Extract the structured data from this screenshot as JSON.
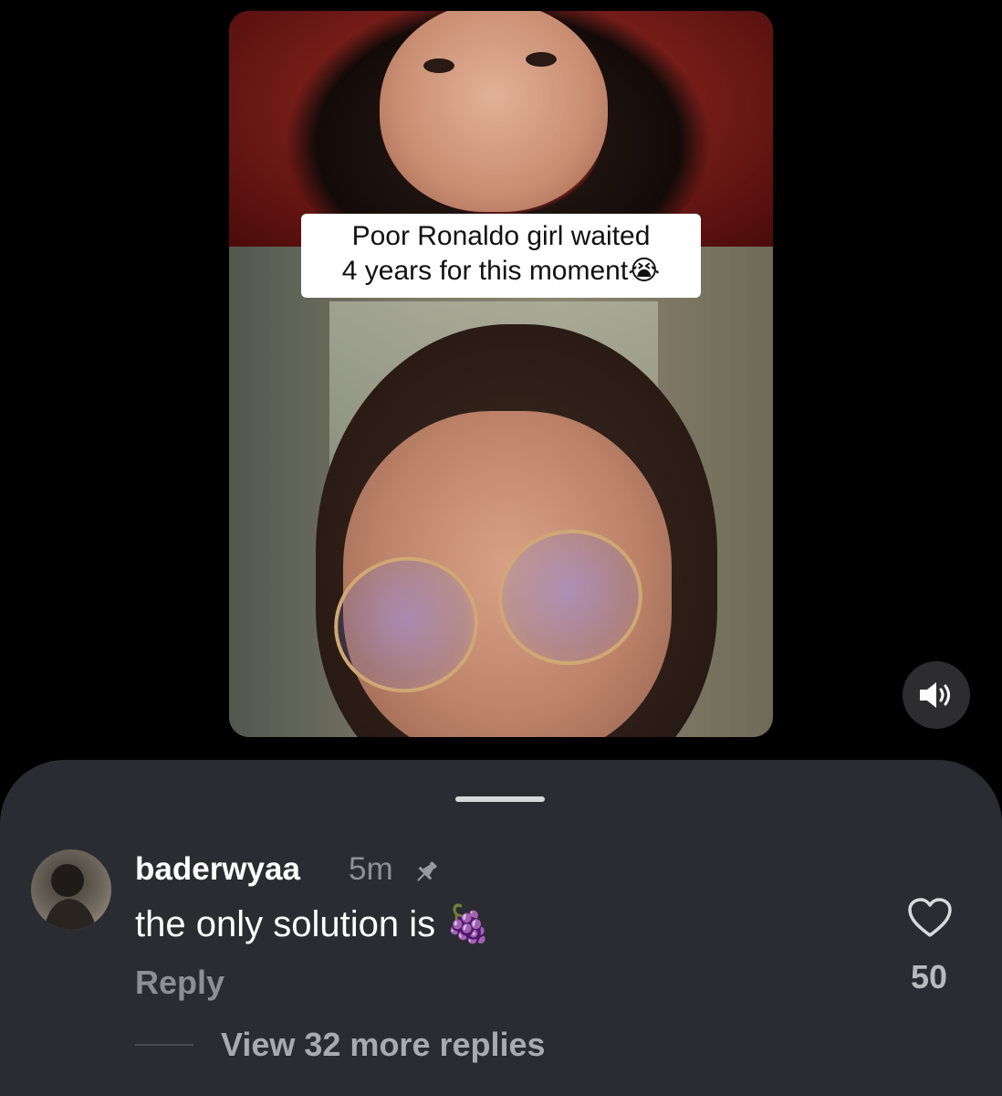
{
  "video": {
    "caption_line1": "Poor Ronaldo girl waited",
    "caption_line2": "4 years for this moment",
    "caption_emoji": "😭"
  },
  "controls": {
    "volume_icon": "speaker-on-icon"
  },
  "comment": {
    "username": "baderwyaa",
    "timestamp": "5m",
    "pin_icon": "pin-icon",
    "text": "the only solution is",
    "text_emoji": "🍇",
    "reply_label": "Reply",
    "like_icon": "heart-icon",
    "like_count": "50",
    "view_replies_label": "View 32 more replies"
  },
  "colors": {
    "background": "#000000",
    "sheet": "#2b2c31",
    "muted_text": "#8e8f94",
    "caption_bg": "#ffffff"
  }
}
